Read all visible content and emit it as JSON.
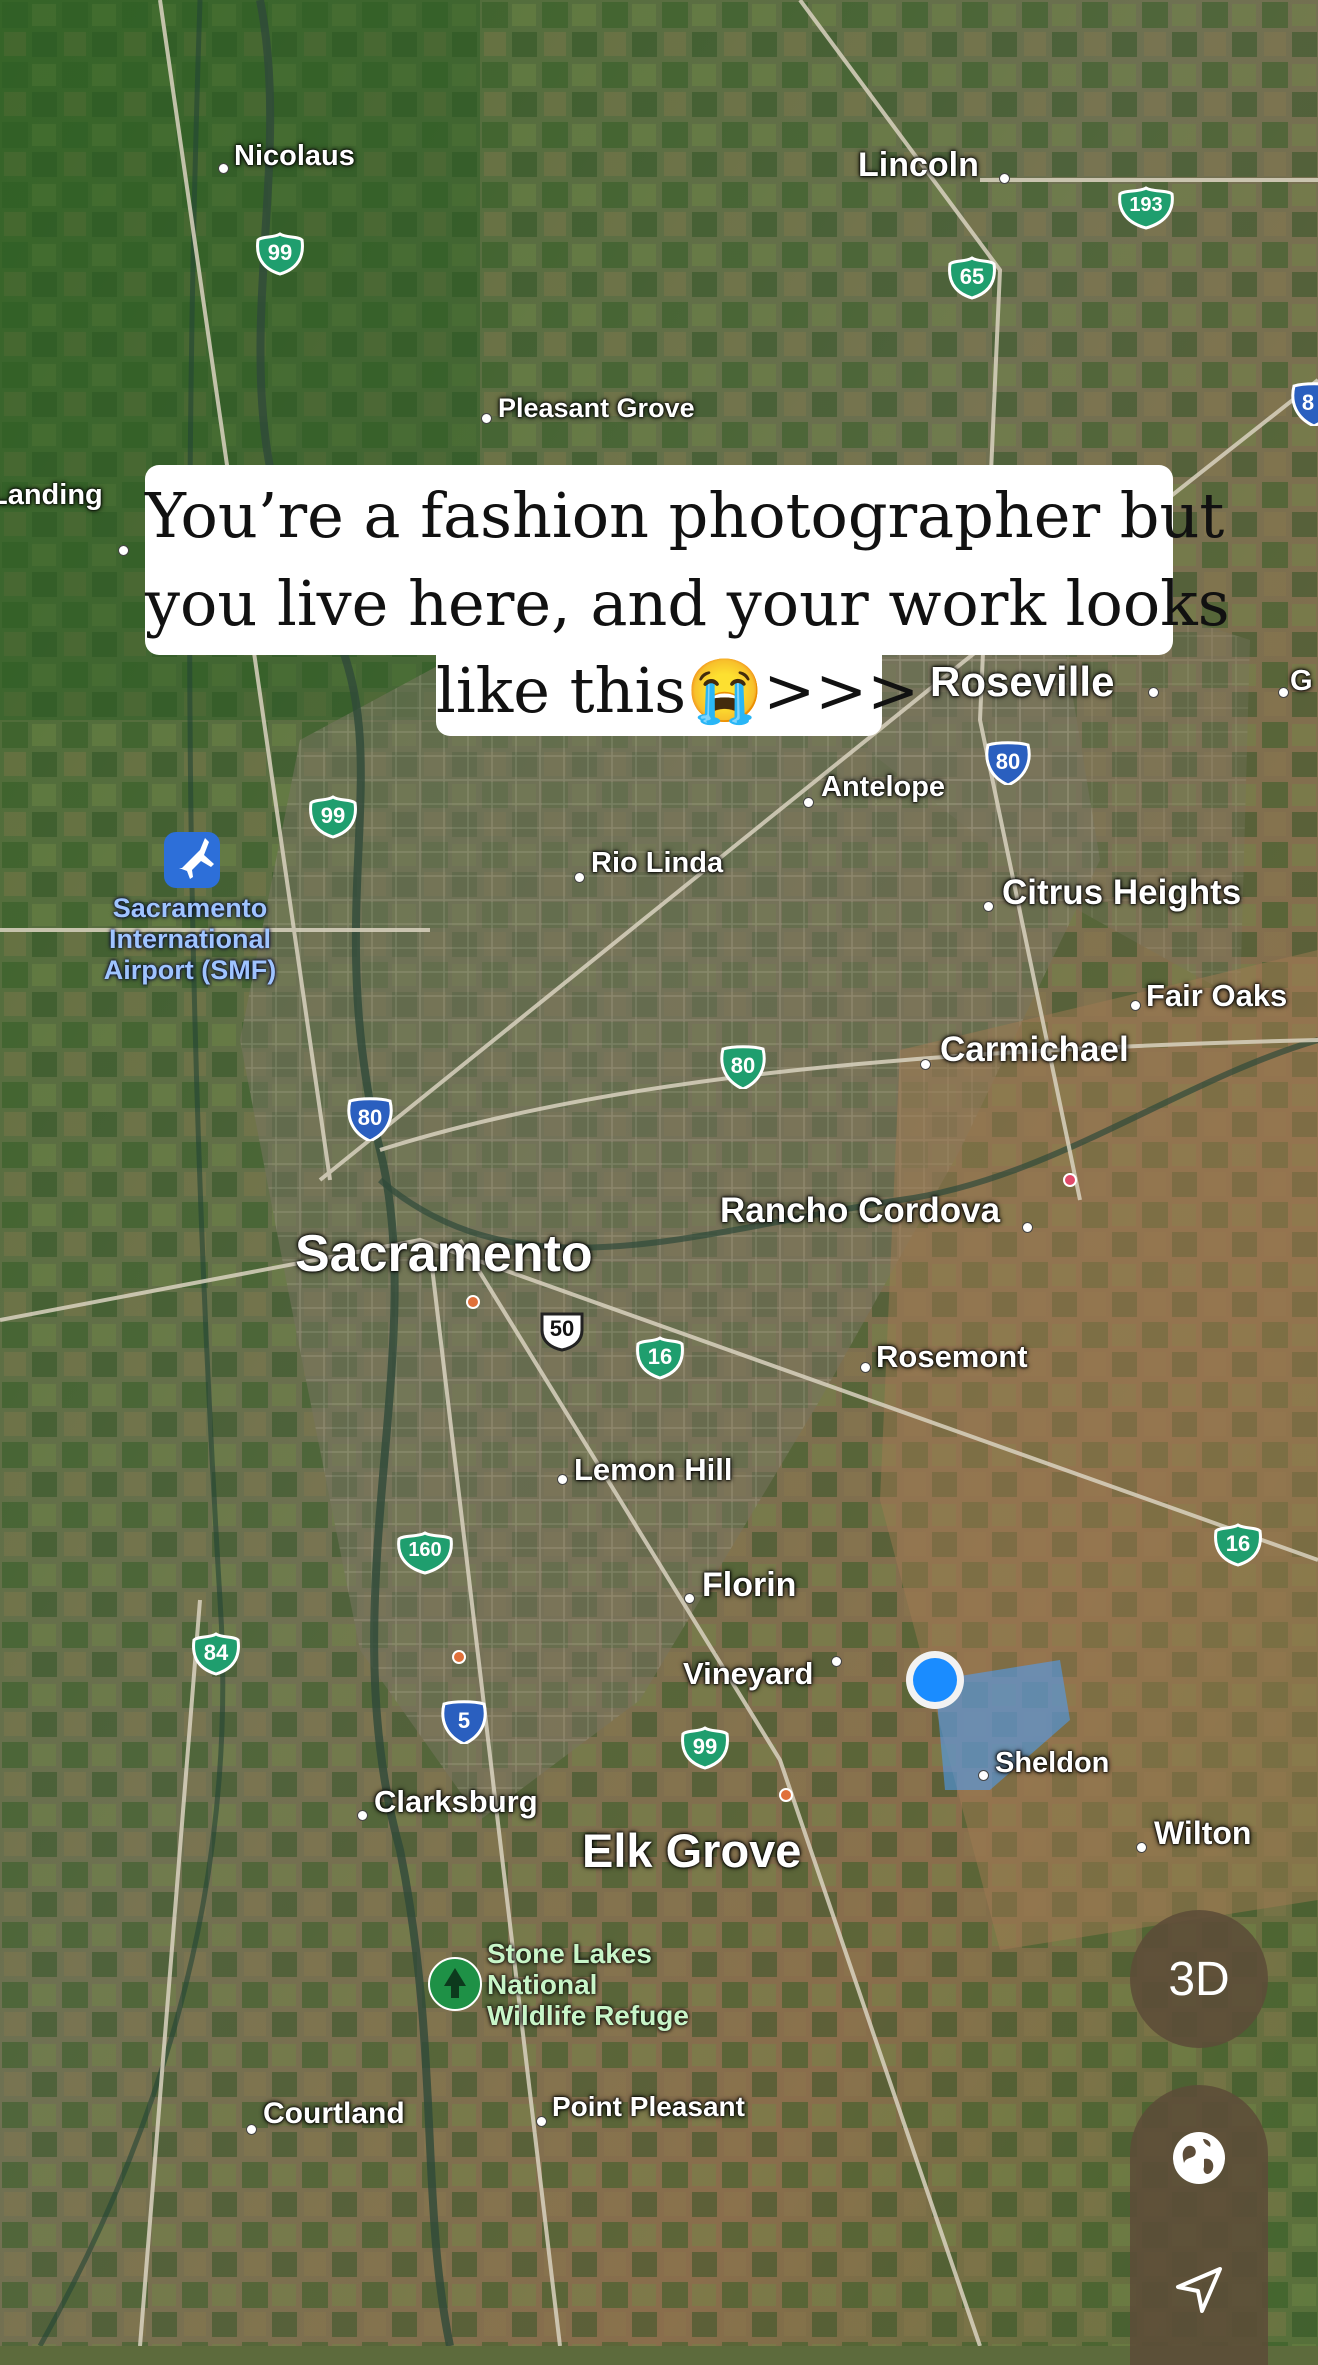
{
  "caption": {
    "line1": "You’re a fashion photographer but",
    "line2": "you live here, and your work looks",
    "line3": "like this😭>>>"
  },
  "places": {
    "nicolaus": "Nicolaus",
    "lincoln": "Lincoln",
    "pleasant_grove": "Pleasant Grove",
    "landing": "Landing",
    "roseville": "Roseville",
    "g": "G",
    "antelope": "Antelope",
    "rio_linda": "Rio Linda",
    "citrus_heights": "Citrus Heights",
    "fair_oaks": "Fair Oaks",
    "carmichael": "Carmichael",
    "sacramento": "Sacramento",
    "rancho_cordova": "Rancho Cordova",
    "rosemont": "Rosemont",
    "lemon_hill": "Lemon Hill",
    "florin": "Florin",
    "vineyard": "Vineyard",
    "sheldon": "Sheldon",
    "clarksburg": "Clarksburg",
    "elk_grove": "Elk Grove",
    "wilton": "Wilton",
    "courtland": "Courtland",
    "point_pleasant": "Point Pleasant"
  },
  "airport": {
    "line1": "Sacramento",
    "line2": "International",
    "line3": "Airport (SMF)",
    "icon": "airplane-icon"
  },
  "refuge": {
    "line1": "Stone Lakes",
    "line2": "National",
    "line3": "Wildlife Refuge",
    "icon": "tree-icon"
  },
  "highways": {
    "nicolaus_99": "99",
    "lincoln_65": "65",
    "hwy_193": "193",
    "i80_edge": "8",
    "i80_roseville": "80",
    "hwy_99_north": "99",
    "i80_central": "80",
    "i80_west": "80",
    "us_50": "50",
    "hwy_16_central": "16",
    "hwy_16_east": "16",
    "hwy_160": "160",
    "hwy_84": "84",
    "i5": "5",
    "hwy_99_south": "99"
  },
  "controls": {
    "three_d_label": "3D",
    "globe_icon": "globe-icon",
    "location_icon": "location-arrow-icon"
  },
  "colors": {
    "user_location": "#1a8cff",
    "state_route": "#1f9e6e",
    "interstate": "#2a5fbf",
    "map_button": "#5c4c38"
  }
}
